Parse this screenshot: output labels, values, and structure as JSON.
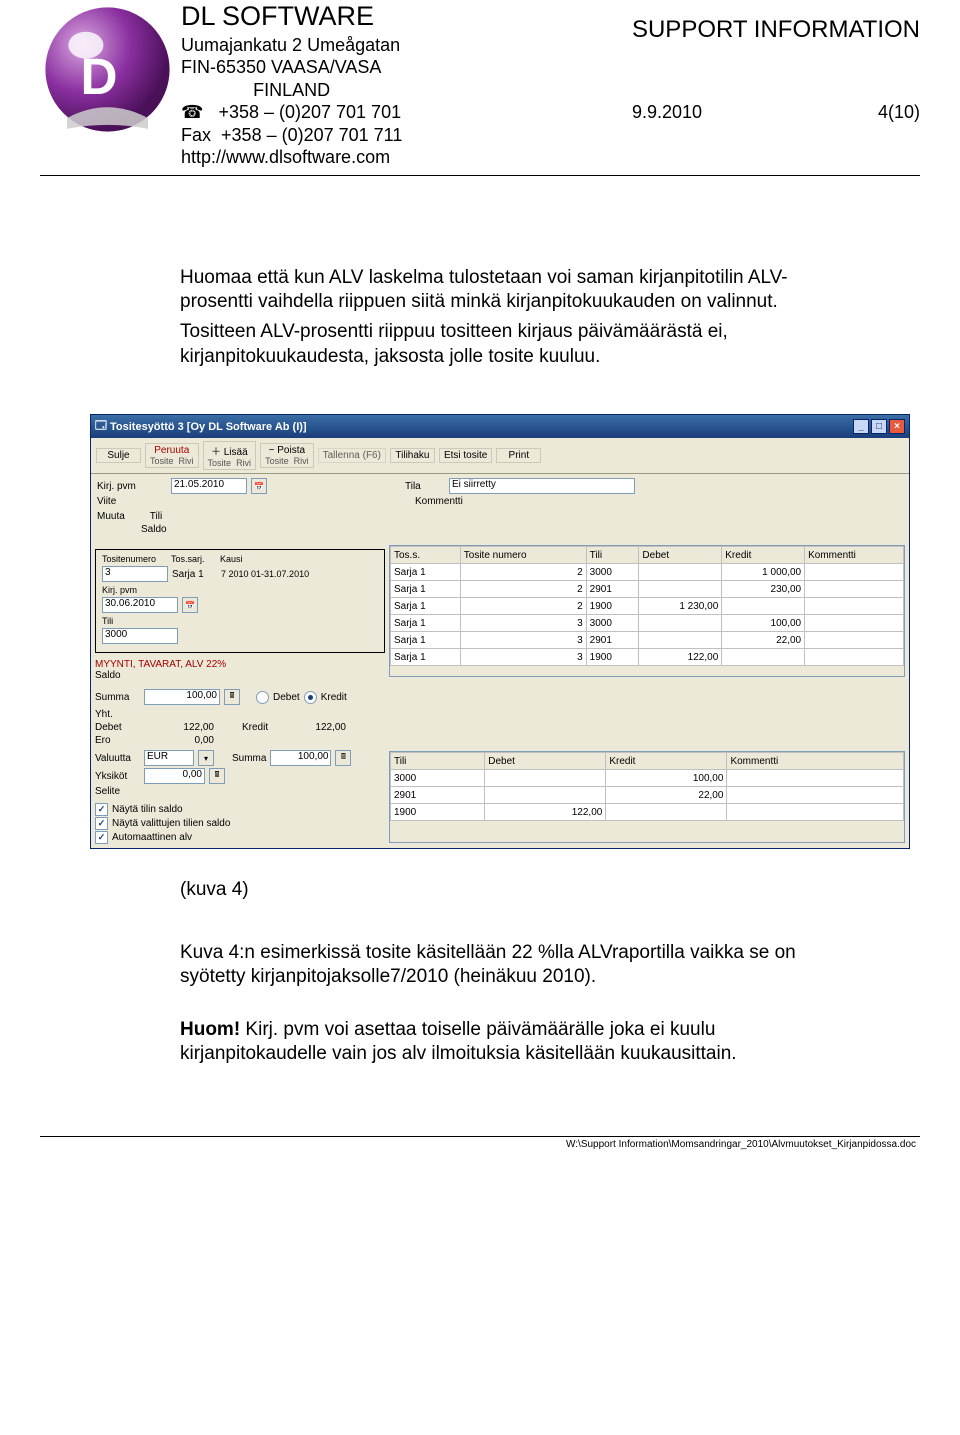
{
  "header": {
    "company_name": "DL SOFTWARE",
    "addr1": "Uumajankatu 2 Umeågatan",
    "addr2": "FIN-65350 VAASA/VASA",
    "addr3": "FINLAND",
    "phone_icon": "☎",
    "phone": "+358 – (0)207 701 701",
    "fax_label": "Fax",
    "fax": "+358 – (0)207 701 711",
    "url": "http://www.dlsoftware.com",
    "right_title": "SUPPORT INFORMATION",
    "date": "9.9.2010",
    "pagenum": "4(10)"
  },
  "body": {
    "p1": "Huomaa että kun ALV laskelma tulostetaan voi saman kirjanpitotilin ALV-prosentti vaihdella riippuen siitä minkä kirjanpitokuukauden on valinnut.",
    "p2": "Tositteen ALV-prosentti riippuu tositteen kirjaus päivämäärästä ei, kirjanpitokuukaudesta, jaksosta jolle tosite kuuluu."
  },
  "kuva_label": "(kuva 4)",
  "bottom": {
    "p1": "Kuva 4:n esimerkissä tosite käsitellään 22 %lla ALVraportilla vaikka se on syötetty kirjanpitojaksolle7/2010 (heinäkuu 2010).",
    "huom_label": "Huom!",
    "huom_text": " Kirj. pvm voi asettaa toiselle päivämäärälle joka ei kuulu kirjanpitokaudelle vain jos alv ilmoituksia käsitellään kuukausittain."
  },
  "footer_path": "W:\\Support Information\\Momsandringar_2010\\Alvmuutokset_Kirjanpidossa.doc",
  "app": {
    "title": "Tositesyöttö 3  [Oy DL Software Ab (I)]",
    "toolbar": {
      "sulje": "Sulje",
      "peruuta": "Peruuta",
      "tosite_sub": "Tosite",
      "rivi_sub": "Rivi",
      "lisaa": "Lisää",
      "poista": "Poista",
      "tallenna": "Tallenna (F6)",
      "tilihaku": "Tilihaku",
      "etsitosite": "Etsi tosite",
      "print": "Print"
    },
    "fields": {
      "kirj_pvm_lbl": "Kirj. pvm",
      "kirj_pvm_val": "21.05.2010",
      "tila_lbl": "Tila",
      "tila_val": "Ei siirretty",
      "viite_lbl": "Viite",
      "kommentti_lbl": "Kommentti",
      "muuta_lbl": "Muuta",
      "tili_lbl": "Tili",
      "saldo_lbl": "Saldo"
    },
    "boxed": {
      "tositenro_lbl": "Tositenumero",
      "tossarj_lbl": "Tos.sarj.",
      "kausi_lbl": "Kausi",
      "tositenro": "3",
      "tossarj": "Sarja 1",
      "kausi": "7 2010 01-31.07.2010",
      "kirj_pvm_lbl": "Kirj. pvm",
      "kirj_pvm": "30.06.2010",
      "tili_lbl": "Tili",
      "tili": "3000"
    },
    "red_line": "MYYNTI, TAVARAT, ALV 22%",
    "saldo_lbl2": "Saldo",
    "summa_lbl": "Summa",
    "summa_val": "100,00",
    "debet_lbl": "Debet",
    "kredit_lbl": "Kredit",
    "yht_lbl": "Yht.",
    "ero_lbl": "Ero",
    "yht_debet": "122,00",
    "yht_kredit": "122,00",
    "ero_val": "0,00",
    "valuutta_lbl": "Valuutta",
    "valuutta_val": "EUR",
    "summa2_lbl": "Summa",
    "summa2_val": "100,00",
    "yksikot_lbl": "Yksiköt",
    "yksikot_val": "0,00",
    "selite_lbl": "Selite",
    "chk1": "Näytä tilin saldo",
    "chk2": "Näytä valittujen tilien saldo",
    "chk3": "Automaattinen alv",
    "grid1": {
      "headers": [
        "Tos.s.",
        "Tosite numero",
        "Tili",
        "Debet",
        "Kredit",
        "Kommentti"
      ],
      "rows": [
        [
          "Sarja 1",
          "2",
          "3000",
          "",
          "1 000,00",
          ""
        ],
        [
          "Sarja 1",
          "2",
          "2901",
          "",
          "230,00",
          ""
        ],
        [
          "Sarja 1",
          "2",
          "1900",
          "1 230,00",
          "",
          ""
        ],
        [
          "Sarja 1",
          "3",
          "3000",
          "",
          "100,00",
          ""
        ],
        [
          "Sarja 1",
          "3",
          "2901",
          "",
          "22,00",
          ""
        ],
        [
          "Sarja 1",
          "3",
          "1900",
          "122,00",
          "",
          ""
        ]
      ]
    },
    "grid2": {
      "headers": [
        "Tili",
        "Debet",
        "Kredit",
        "Kommentti"
      ],
      "rows": [
        [
          "3000",
          "",
          "100,00",
          ""
        ],
        [
          "2901",
          "",
          "22,00",
          ""
        ],
        [
          "1900",
          "122,00",
          "",
          ""
        ]
      ]
    }
  }
}
